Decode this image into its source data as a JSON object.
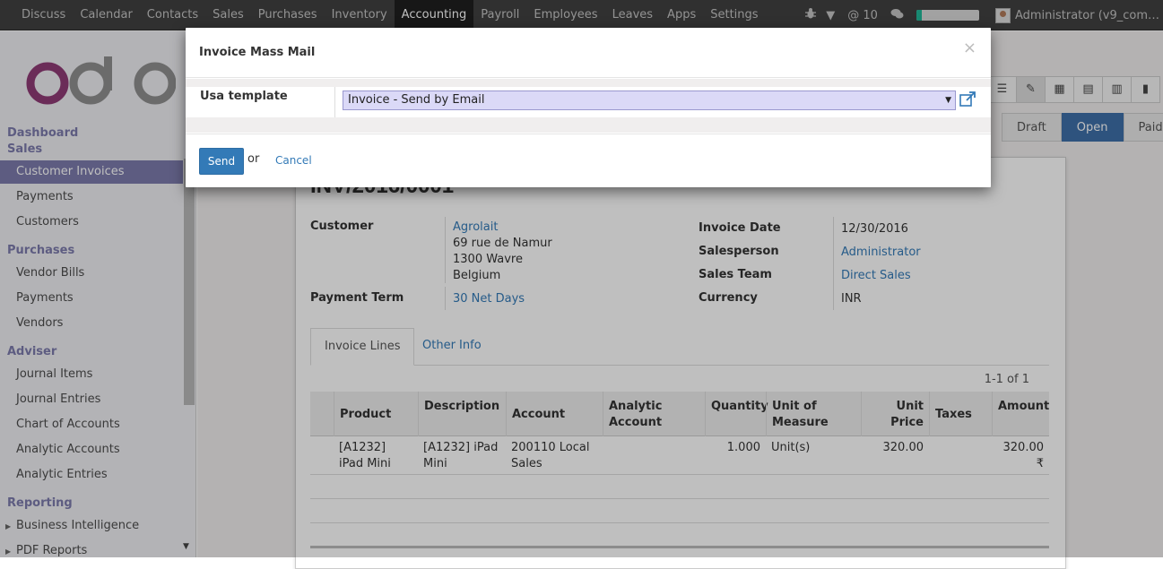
{
  "navbar": {
    "menu": [
      "Discuss",
      "Calendar",
      "Contacts",
      "Sales",
      "Purchases",
      "Inventory",
      "Accounting",
      "Payroll",
      "Employees",
      "Leaves",
      "Apps",
      "Settings"
    ],
    "active_index": 6,
    "notifications": "@ 10",
    "progress_pct": 0.08,
    "user": "Administrator (v9_com…"
  },
  "sidebar": {
    "sections": [
      {
        "header": "Dashboard"
      },
      {
        "header": "Sales",
        "items": [
          "Customer Invoices",
          "Payments",
          "Customers"
        ]
      },
      {
        "header": "Purchases",
        "items": [
          "Vendor Bills",
          "Payments",
          "Vendors"
        ]
      },
      {
        "header": "Adviser",
        "items": [
          "Journal Items",
          "Journal Entries",
          "Chart of Accounts",
          "Analytic Accounts",
          "Analytic Entries"
        ]
      },
      {
        "header": "Reporting",
        "items": [
          "Business Intelligence",
          "PDF Reports"
        ]
      }
    ],
    "active_item": "Customer Invoices"
  },
  "statusbar": [
    "Draft",
    "Open",
    "Paid"
  ],
  "status_active": "Open",
  "invoice": {
    "number": "INV/2016/0001",
    "labels": {
      "customer": "Customer",
      "payment_term": "Payment Term",
      "invoice_date": "Invoice Date",
      "salesperson": "Salesperson",
      "sales_team": "Sales Team",
      "currency": "Currency"
    },
    "customer_name": "Agrolait",
    "address": [
      "69 rue de Namur",
      "1300 Wavre",
      "Belgium"
    ],
    "payment_term": "30 Net Days",
    "invoice_date": "12/30/2016",
    "salesperson": "Administrator",
    "sales_team": "Direct Sales",
    "currency": "INR"
  },
  "tabs": [
    "Invoice Lines",
    "Other Info"
  ],
  "pager": "1-1 of 1",
  "lines": {
    "headers": [
      "Product",
      "Description",
      "Account",
      "Analytic Account",
      "Quantity",
      "Unit of Measure",
      "Unit Price",
      "Taxes",
      "Amount"
    ],
    "rows": [
      {
        "product": "[A1232] iPad Mini",
        "description": "[A1232] iPad Mini",
        "account": "200110 Local Sales",
        "analytic": "",
        "quantity": "1.000",
        "uom": "Unit(s)",
        "unit_price": "320.00",
        "taxes": "",
        "amount": "320.00 ₹"
      }
    ]
  },
  "modal": {
    "title": "Invoice Mass Mail",
    "field_label": "Usa template",
    "field_value": "Invoice - Send by Email",
    "close": "×",
    "send": "Send",
    "or": "or",
    "cancel": "Cancel"
  }
}
